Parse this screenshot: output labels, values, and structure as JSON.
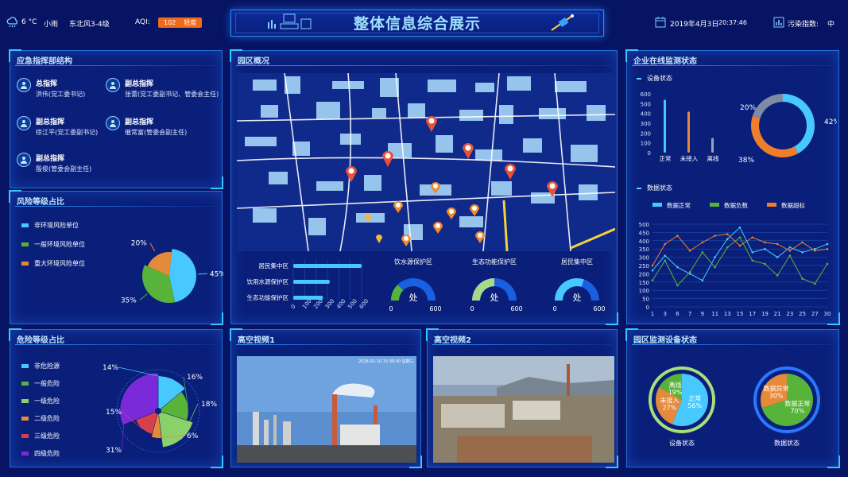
{
  "header": {
    "temp": "6 °C",
    "weather": "小雨",
    "wind": "东北风3-4级",
    "aqi_label": "AQI:",
    "aqi_value": "102",
    "aqi_level": "轻度",
    "title": "整体信息综合展示",
    "date": "2019年4月3日",
    "time": "20:37:46",
    "pollution_label": "污染指数:",
    "pollution_value": "中"
  },
  "command": {
    "title": "应急指挥部结构",
    "leaders": [
      {
        "role": "总指挥",
        "name": "洪伟(党工委书记)"
      },
      {
        "role": "副总指挥",
        "name": "张蕾(党工委副书记、管委会主任)"
      },
      {
        "role": "副总指挥",
        "name": "徐江平(党工委副书记)"
      },
      {
        "role": "副总指挥",
        "name": "催常富(管委会副主任)"
      },
      {
        "role": "副总指挥",
        "name": "殷俊(管委会副主任)"
      }
    ]
  },
  "risk": {
    "title": "风险等级占比",
    "legend": [
      "非环境风险单位",
      "一般环境风险单位",
      "重大环境风险单位"
    ],
    "colors": [
      "#47c8ff",
      "#58b33a",
      "#e58a3a"
    ],
    "values": [
      45,
      35,
      20
    ],
    "labels": [
      "45%",
      "35%",
      "20%"
    ]
  },
  "danger": {
    "title": "危险等级占比",
    "legend": [
      "非危险源",
      "一般危险",
      "一级危险",
      "二级危险",
      "三级危险",
      "四级危险"
    ],
    "colors": [
      "#47c8ff",
      "#58b33a",
      "#8bd16a",
      "#e58a3a",
      "#d6404a",
      "#7a2ad8"
    ],
    "values": [
      14,
      16,
      18,
      6,
      15,
      31
    ],
    "labels": [
      "14%",
      "16%",
      "18%",
      "6%",
      "15%",
      "31%"
    ]
  },
  "park": {
    "title": "园区概况",
    "bars": {
      "categories": [
        "居民集中区",
        "饮用水源保护区",
        "生态功能保护区"
      ],
      "values": [
        600,
        320,
        260
      ],
      "ticks": [
        "0",
        "100",
        "200",
        "300",
        "400",
        "500",
        "600"
      ],
      "max": 600
    },
    "gauges": [
      {
        "title": "饮水源保护区",
        "center": "处",
        "min": "0",
        "max": "600",
        "value": 0.25,
        "color": "#58b33a"
      },
      {
        "title": "生态功能保护区",
        "center": "处",
        "min": "0",
        "max": "600",
        "value": 0.5,
        "color": "#a7d98a"
      },
      {
        "title": "居民集中区",
        "center": "处",
        "min": "0",
        "max": "600",
        "value": 0.6,
        "color": "#47c8ff"
      }
    ]
  },
  "video1": {
    "title": "高空视频1",
    "overlay": "2018-01-10 15:30:00 星期三"
  },
  "video2": {
    "title": "高空视频2"
  },
  "online": {
    "title": "企业在线监测状态",
    "device_title": "设备状态",
    "device": {
      "categories": [
        "正常",
        "未接入",
        "离线"
      ],
      "values": [
        540,
        420,
        150
      ],
      "colors": [
        "#47c8ff",
        "#e58a3a",
        "#9aa4b8"
      ],
      "ticks": [
        "0",
        "100",
        "200",
        "300",
        "400",
        "500",
        "600"
      ],
      "max": 600
    },
    "donut": {
      "values": [
        42,
        38,
        20
      ],
      "labels": [
        "42%",
        "38%",
        "20%"
      ],
      "colors": [
        "#47c8ff",
        "#f07d2c",
        "#7f8aa3"
      ]
    },
    "data_title": "数据状态",
    "line": {
      "legend": [
        "数据正常",
        "数据负数",
        "数据超标"
      ],
      "colors": [
        "#47c8ff",
        "#58b33a",
        "#f07d2c"
      ],
      "x": [
        "1",
        "3",
        "6",
        "7",
        "9",
        "11",
        "13",
        "15",
        "17",
        "19",
        "21",
        "23",
        "25",
        "27",
        "30"
      ],
      "y_ticks": [
        "0",
        "50",
        "100",
        "150",
        "200",
        "250",
        "300",
        "350",
        "400",
        "450",
        "500"
      ],
      "ymax": 500,
      "series": [
        {
          "name": "数据正常",
          "values": [
            220,
            310,
            240,
            200,
            160,
            300,
            410,
            480,
            330,
            350,
            300,
            360,
            330,
            350,
            380
          ]
        },
        {
          "name": "数据负数",
          "values": [
            160,
            280,
            130,
            210,
            330,
            240,
            360,
            420,
            280,
            260,
            190,
            310,
            170,
            140,
            260
          ]
        },
        {
          "name": "数据超标",
          "values": [
            250,
            380,
            430,
            340,
            390,
            430,
            440,
            370,
            420,
            390,
            380,
            340,
            390,
            340,
            350
          ]
        }
      ]
    }
  },
  "device_status": {
    "title": "园区监测设备状态",
    "pie1": {
      "caption": "设备状态",
      "values": [
        56,
        27,
        17
      ],
      "labels": [
        "正常\n56%",
        "未接入\n27%",
        "离线\n19%"
      ],
      "colors": [
        "#47c8ff",
        "#e58a3a",
        "#58b33a"
      ],
      "ring": "#a7e07a"
    },
    "pie2": {
      "caption": "数据状态",
      "values": [
        70,
        30
      ],
      "labels": [
        "数据正常\n70%",
        "数据异常\n30%"
      ],
      "colors": [
        "#58b33a",
        "#e58a3a"
      ],
      "ring": "#2a78ff"
    }
  }
}
